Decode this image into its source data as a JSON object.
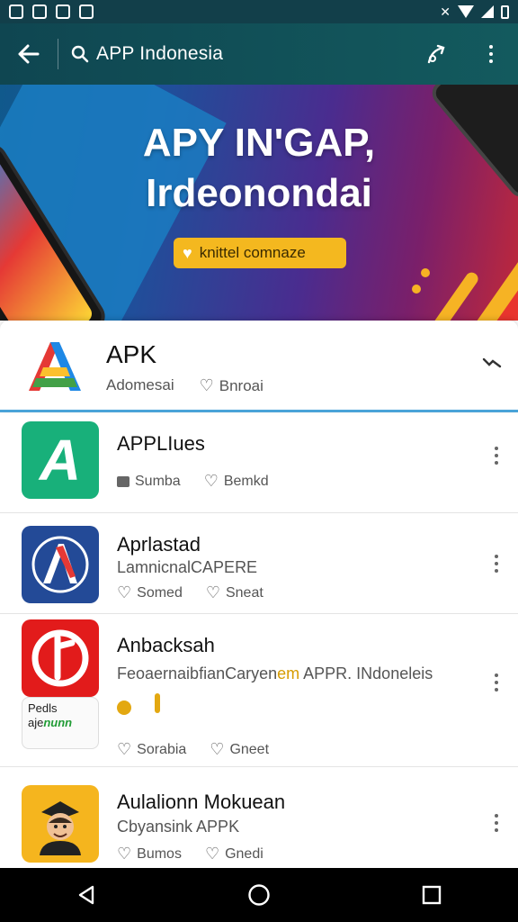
{
  "app_bar": {
    "search_text": "APP Indonesia"
  },
  "banner": {
    "title_line1": "APY IN'GAP,",
    "title_line2": "Irdeonondai",
    "pill_text": "knittel comnaze"
  },
  "featured": {
    "title": "APK",
    "meta_left": "Adomesai",
    "meta_right": "Bnroai"
  },
  "items": [
    {
      "title": "APPLIues",
      "sub": "",
      "meta_left": "Sumba",
      "meta_right": "Bemkd"
    },
    {
      "title": "Aprlastad",
      "sub": "LamnicnalCAPERE",
      "meta_left": "Somed",
      "meta_right": "Sneat"
    },
    {
      "title": "Anbacksah",
      "sub_main": "FeoaernaibfianCaryen",
      "sub_hl": "em",
      "sub_tail": "APPR. INdoneleis",
      "sticker_l1": "Pedls",
      "sticker_l2a": "aje",
      "sticker_l2b": "nunn",
      "meta_left": "Sorabia",
      "meta_right": "Gneet"
    },
    {
      "title": "Aulalionn Mokuean",
      "sub": "Cbyansink APPK",
      "meta_left": "Bumos",
      "meta_right": "Gnedi"
    }
  ],
  "colors": {
    "app_bar": "#0f4651",
    "status_bar": "#123f4a",
    "accent": "#4aa3d8",
    "banner_pill": "#f4b81f"
  }
}
